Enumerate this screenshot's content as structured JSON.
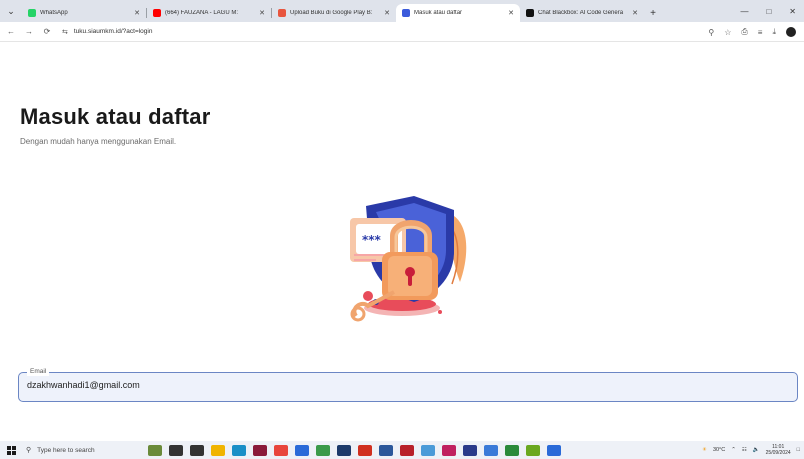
{
  "browser": {
    "tabs": [
      {
        "title": "WhatsApp",
        "fav_color": "#25d366",
        "active": false
      },
      {
        "title": "(664) FAUZANA - LAGU M:",
        "fav_color": "#ff0000",
        "active": false
      },
      {
        "title": "Upload Buku di Google Play B:",
        "fav_color": "#e8553e",
        "active": false
      },
      {
        "title": "Masuk atau daftar",
        "fav_color": "#3b5bdb",
        "active": true
      },
      {
        "title": "Chat Blackbox: AI Code Genera",
        "fav_color": "#111111",
        "active": false
      }
    ],
    "new_tab": "+",
    "url": "tuku.siaumkm.id/?act=login"
  },
  "page": {
    "title": "Masuk atau daftar",
    "subtitle": "Dengan mudah hanya menggunakan Email.",
    "illustration": "padlock-shield-icon",
    "email_label": "Email",
    "email_value": "dzakhwanhadi1@gmail.com"
  },
  "taskbar": {
    "search_placeholder": "Type here to search",
    "weather": "30°C",
    "time": "11:01",
    "date": "25/09/2024",
    "icons": [
      "people-icon",
      "cortana-icon",
      "task-view-icon",
      "file-explorer-icon",
      "edge-icon",
      "media-icon",
      "chrome-icon",
      "store-icon",
      "paint-icon",
      "photoshop-icon",
      "acrobat-icon",
      "word-icon",
      "filezilla-icon",
      "app-icon",
      "app-icon-2",
      "pen-icon",
      "app-icon-3",
      "app-icon-4",
      "app-icon-5",
      "app-icon-6"
    ],
    "icon_colors": [
      "#6a8a3a",
      "#333333",
      "#333333",
      "#f0b400",
      "#1a8fc7",
      "#8a1a3a",
      "#e8453c",
      "#2a6ad8",
      "#3a9a4a",
      "#1c3a6a",
      "#d03020",
      "#2b579a",
      "#b8202a",
      "#4a9ad8",
      "#c02060",
      "#2a3a8a",
      "#3a7ad8",
      "#2a8a3a",
      "#6aa820",
      "#2a6ad8"
    ]
  }
}
